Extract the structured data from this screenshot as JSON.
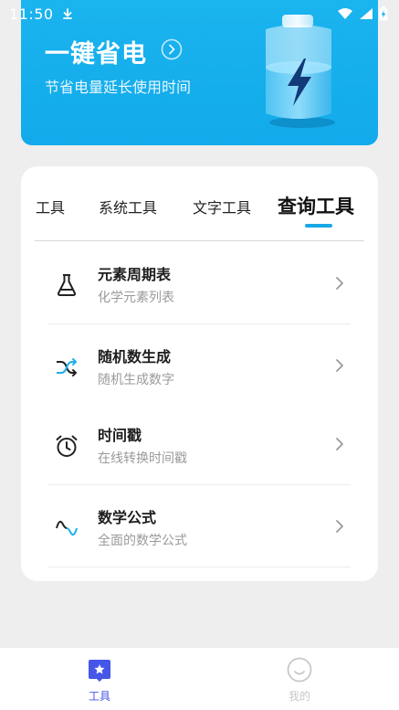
{
  "status_bar": {
    "time": "11:50"
  },
  "banner": {
    "title": "一键省电",
    "subtitle": "节省电量延长使用时间"
  },
  "tabs": [
    {
      "label": "工具"
    },
    {
      "label": "系统工具"
    },
    {
      "label": "文字工具"
    },
    {
      "label": "查询工具",
      "active": true
    }
  ],
  "items": [
    {
      "title": "元素周期表",
      "subtitle": "化学元素列表",
      "icon": "flask-icon"
    },
    {
      "title": "随机数生成",
      "subtitle": "随机生成数字",
      "icon": "shuffle-icon"
    },
    {
      "title": "时间戳",
      "subtitle": "在线转换时间戳",
      "icon": "alarm-clock-icon"
    },
    {
      "title": "数学公式",
      "subtitle": "全面的数学公式",
      "icon": "sine-wave-icon"
    }
  ],
  "bottom_nav": [
    {
      "label": "工具",
      "icon": "star-badge-icon",
      "active": true
    },
    {
      "label": "我的",
      "icon": "smile-icon",
      "active": false
    }
  ],
  "colors": {
    "accent": "#18a8e6",
    "banner": "#12aaea",
    "nav_active": "#4556e8",
    "nav_inactive": "#c8c8c8"
  }
}
